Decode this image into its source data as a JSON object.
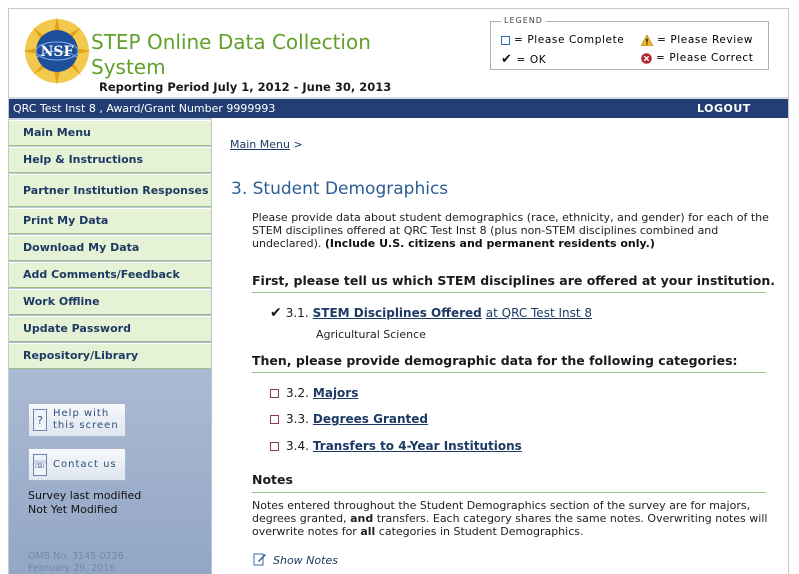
{
  "header": {
    "title_line1": "STEP Online Data Collection",
    "title_line2": "System",
    "reporting_period": "Reporting Period July 1, 2012 - June 30, 2013",
    "logo_text": "NSF",
    "legend": {
      "title": "LEGEND",
      "complete": "= Please Complete",
      "review": "= Please Review",
      "ok": "= OK",
      "correct": "= Please Correct"
    }
  },
  "bluebar": {
    "award": "QRC Test Inst 8 , Award/Grant Number 9999993",
    "logout": "LOGOUT"
  },
  "sidebar": {
    "items": [
      {
        "label": "Main Menu"
      },
      {
        "label": "Help & Instructions"
      },
      {
        "label": "Partner Institution Responses"
      },
      {
        "label": "Print My Data"
      },
      {
        "label": "Download My Data"
      },
      {
        "label": "Add Comments/Feedback"
      },
      {
        "label": "Work Offline"
      },
      {
        "label": "Update Password"
      },
      {
        "label": "Repository/Library"
      }
    ],
    "help_button_line1": "Help with",
    "help_button_line2": "this screen",
    "contact_button": "Contact us",
    "survey_modified_label": "Survey last modified",
    "survey_modified_value": "Not Yet Modified",
    "omb_number": "OMB No. 3145-0226",
    "omb_date": "February 29, 2016"
  },
  "main": {
    "breadcrumb_link": "Main Menu",
    "breadcrumb_sep": ">",
    "section_title": "3. Student Demographics",
    "intro_text": "Please provide data about student demographics (race, ethnicity, and gender) for each of the STEM disciplines offered at QRC Test Inst 8 (plus non-STEM disciplines combined and undeclared).",
    "intro_bold": "(Include U.S. citizens and permanent residents only.)",
    "first_heading": "First, please tell us which STEM disciplines are offered at your institution.",
    "disciplines_number": "3.1.",
    "disciplines_link": "STEM Disciplines Offered",
    "disciplines_at": "at QRC Test Inst 8",
    "disciplines_note": "Agricultural Science",
    "then_heading": "Then, please provide demographic data for the following categories:",
    "categories": [
      {
        "number": "3.2.",
        "label": "Majors"
      },
      {
        "number": "3.3.",
        "label": "Degrees Granted"
      },
      {
        "number": "3.4.",
        "label": "Transfers to 4-Year Institutions"
      }
    ],
    "notes_heading": "Notes",
    "notes_text_1": "Notes entered throughout the Student Demographics section of the survey are for majors, degrees granted,",
    "notes_and": "and",
    "notes_text_2": "transfers. Each category shares the same notes. Overwriting notes will overwrite notes for",
    "notes_all": "all",
    "notes_text_3": "categories in Student Demographics.",
    "show_notes": "Show Notes"
  },
  "colors": {
    "title_green": "#62a02a",
    "bar_navy": "#223e74",
    "menu_green": "#e6f2d5",
    "link_navy": "#1c3a63",
    "heading_blue": "#2c5c95"
  }
}
